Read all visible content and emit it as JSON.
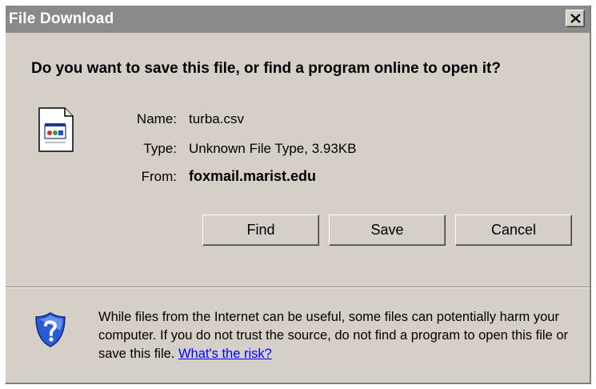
{
  "window": {
    "title": "File Download",
    "close_label": "×"
  },
  "dialog": {
    "question": "Do you want to save this file, or find a program online to open it?",
    "file_info": {
      "name_label": "Name:",
      "name_value": "turba.csv",
      "type_label": "Type:",
      "type_value": "Unknown File Type, 3.93KB",
      "from_label": "From:",
      "from_value": "foxmail.marist.edu"
    },
    "buttons": {
      "find": "Find",
      "save": "Save",
      "cancel": "Cancel"
    },
    "warning": {
      "text": "While files from the Internet can be useful, some files can potentially harm your computer. If you do not trust the source, do not find a program to open this file or save this file.",
      "link": "What's the risk?"
    }
  },
  "icons": {
    "file": "csv-file-icon",
    "shield": "security-shield-question-icon",
    "close": "close-icon"
  },
  "colors": {
    "dialog_bg": "#d4d0c8",
    "titlebar_bg": "#8a8a8a",
    "link": "#0000ff",
    "shield_blue": "#2a5bd7"
  }
}
